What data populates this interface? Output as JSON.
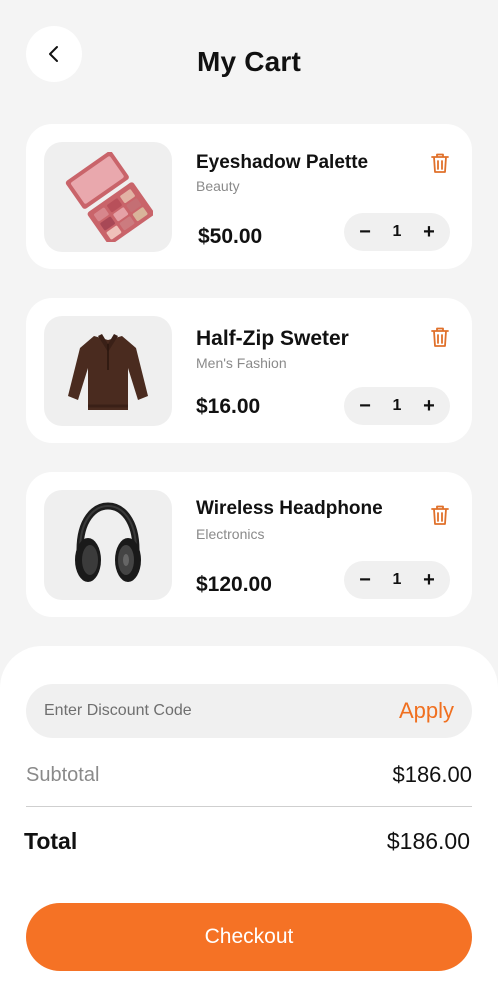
{
  "header": {
    "title": "My Cart",
    "back_icon": "chevron-left-icon"
  },
  "items": [
    {
      "name": "Eyeshadow Palette",
      "category": "Beauty",
      "price": "$50.00",
      "quantity": "1",
      "image": "eyeshadow-palette-image"
    },
    {
      "name": "Half-Zip Sweter",
      "category": "Men's Fashion",
      "price": "$16.00",
      "quantity": "1",
      "image": "sweater-image"
    },
    {
      "name": "Wireless Headphone",
      "category": "Electronics",
      "price": "$120.00",
      "quantity": "1",
      "image": "headphone-image"
    }
  ],
  "quantity_controls": {
    "minus": "−",
    "plus": "+"
  },
  "discount": {
    "placeholder": "Enter Discount Code",
    "apply_label": "Apply"
  },
  "summary": {
    "subtotal_label": "Subtotal",
    "subtotal_value": "$186.00",
    "total_label": "Total",
    "total_value": "$186.00"
  },
  "checkout": {
    "label": "Checkout"
  },
  "colors": {
    "accent": "#f57225",
    "delete": "#e0702a",
    "background": "#f4f4f4"
  }
}
